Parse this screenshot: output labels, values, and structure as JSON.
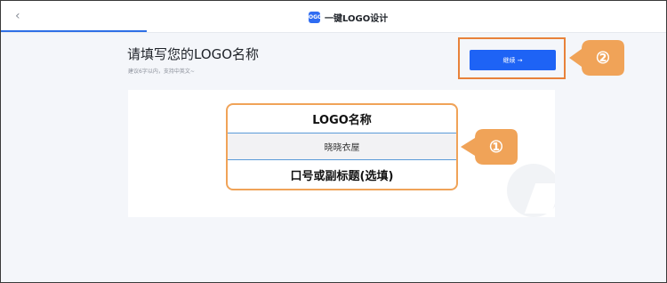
{
  "header": {
    "back_icon": "chevron-left-icon",
    "logo_icon_text": "lOGO",
    "title": "一键LOGO设计"
  },
  "main": {
    "heading": "请填写您的LOGO名称",
    "subheading": "建议6字以内，支持中英文~",
    "continue_label": "继续 →"
  },
  "form": {
    "name_label": "LOGO名称",
    "name_value": "晓晓衣屋",
    "slogan_label": "口号或副标题(选填)"
  },
  "annotations": {
    "badge1": "①",
    "badge2": "②",
    "color": "#f0a358"
  },
  "colors": {
    "accent": "#1e63f5",
    "highlight_border": "#e8823a"
  }
}
